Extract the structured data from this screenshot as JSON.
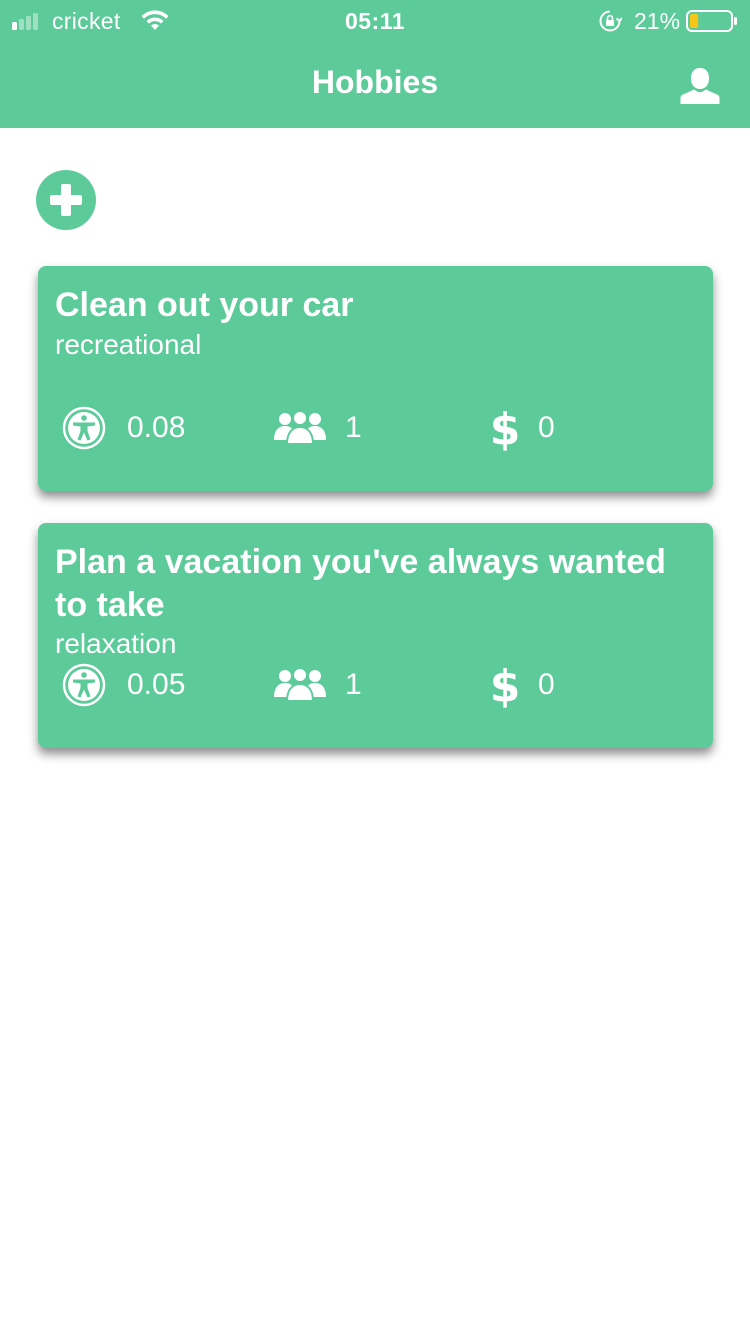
{
  "status_bar": {
    "carrier": "cricket",
    "time": "05:11",
    "battery_percent": "21%",
    "battery_level": 0.21
  },
  "nav": {
    "title": "Hobbies",
    "profile_icon": "user-icon"
  },
  "add_button": {
    "icon": "plus-icon"
  },
  "activities": [
    {
      "title": "Clean out your car",
      "category": "recreational",
      "accessibility": "0.08",
      "participants": "1",
      "price": "0"
    },
    {
      "title": "Plan a vacation you've always wanted to take",
      "category": "relaxation",
      "accessibility": "0.05",
      "participants": "1",
      "price": "0"
    }
  ],
  "colors": {
    "accent": "#5cca99",
    "text_on_accent": "#ffffff",
    "battery_fill": "#f5c518"
  }
}
